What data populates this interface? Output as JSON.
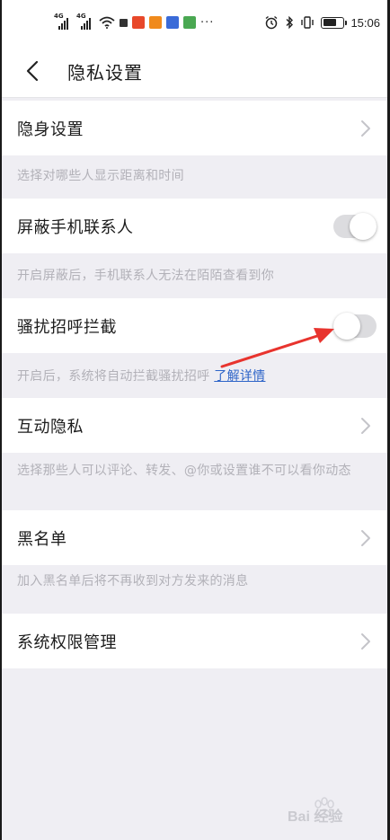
{
  "status_bar": {
    "time": "15:06",
    "network_label_1": "4G",
    "network_label_2": "4G",
    "app_icon_colors": [
      "#e8482a",
      "#f08a1c",
      "#3a6bd8",
      "#4aa852"
    ]
  },
  "nav": {
    "title": "隐私设置",
    "back_icon": "chevron-left-icon"
  },
  "sections": [
    {
      "label": "隐身设置",
      "control": "chevron",
      "description": "选择对哪些人显示距离和时间"
    },
    {
      "label": "屏蔽手机联系人",
      "control": "toggle",
      "toggle_on": false,
      "description": "开启屏蔽后，手机联系人无法在陌陌查看到你"
    },
    {
      "label": "骚扰招呼拦截",
      "control": "toggle",
      "toggle_on": false,
      "description": "开启后，系统将自动拦截骚扰招呼",
      "description_link": "了解详情"
    },
    {
      "label": "互动隐私",
      "control": "chevron",
      "description": "选择那些人可以评论、转发、@你或设置谁不可以看你动态"
    },
    {
      "label": "黑名单",
      "control": "chevron",
      "description": "加入黑名单后将不再收到对方发来的消息"
    },
    {
      "label": "系统权限管理",
      "control": "chevron"
    }
  ],
  "annotation": {
    "arrow_color": "#e8342e"
  },
  "watermark": {
    "text": "Bai 经验"
  },
  "colors": {
    "background": "#efeef3",
    "row_background": "#ffffff",
    "description_text": "#b2b1b8",
    "link": "#2d64c8"
  }
}
